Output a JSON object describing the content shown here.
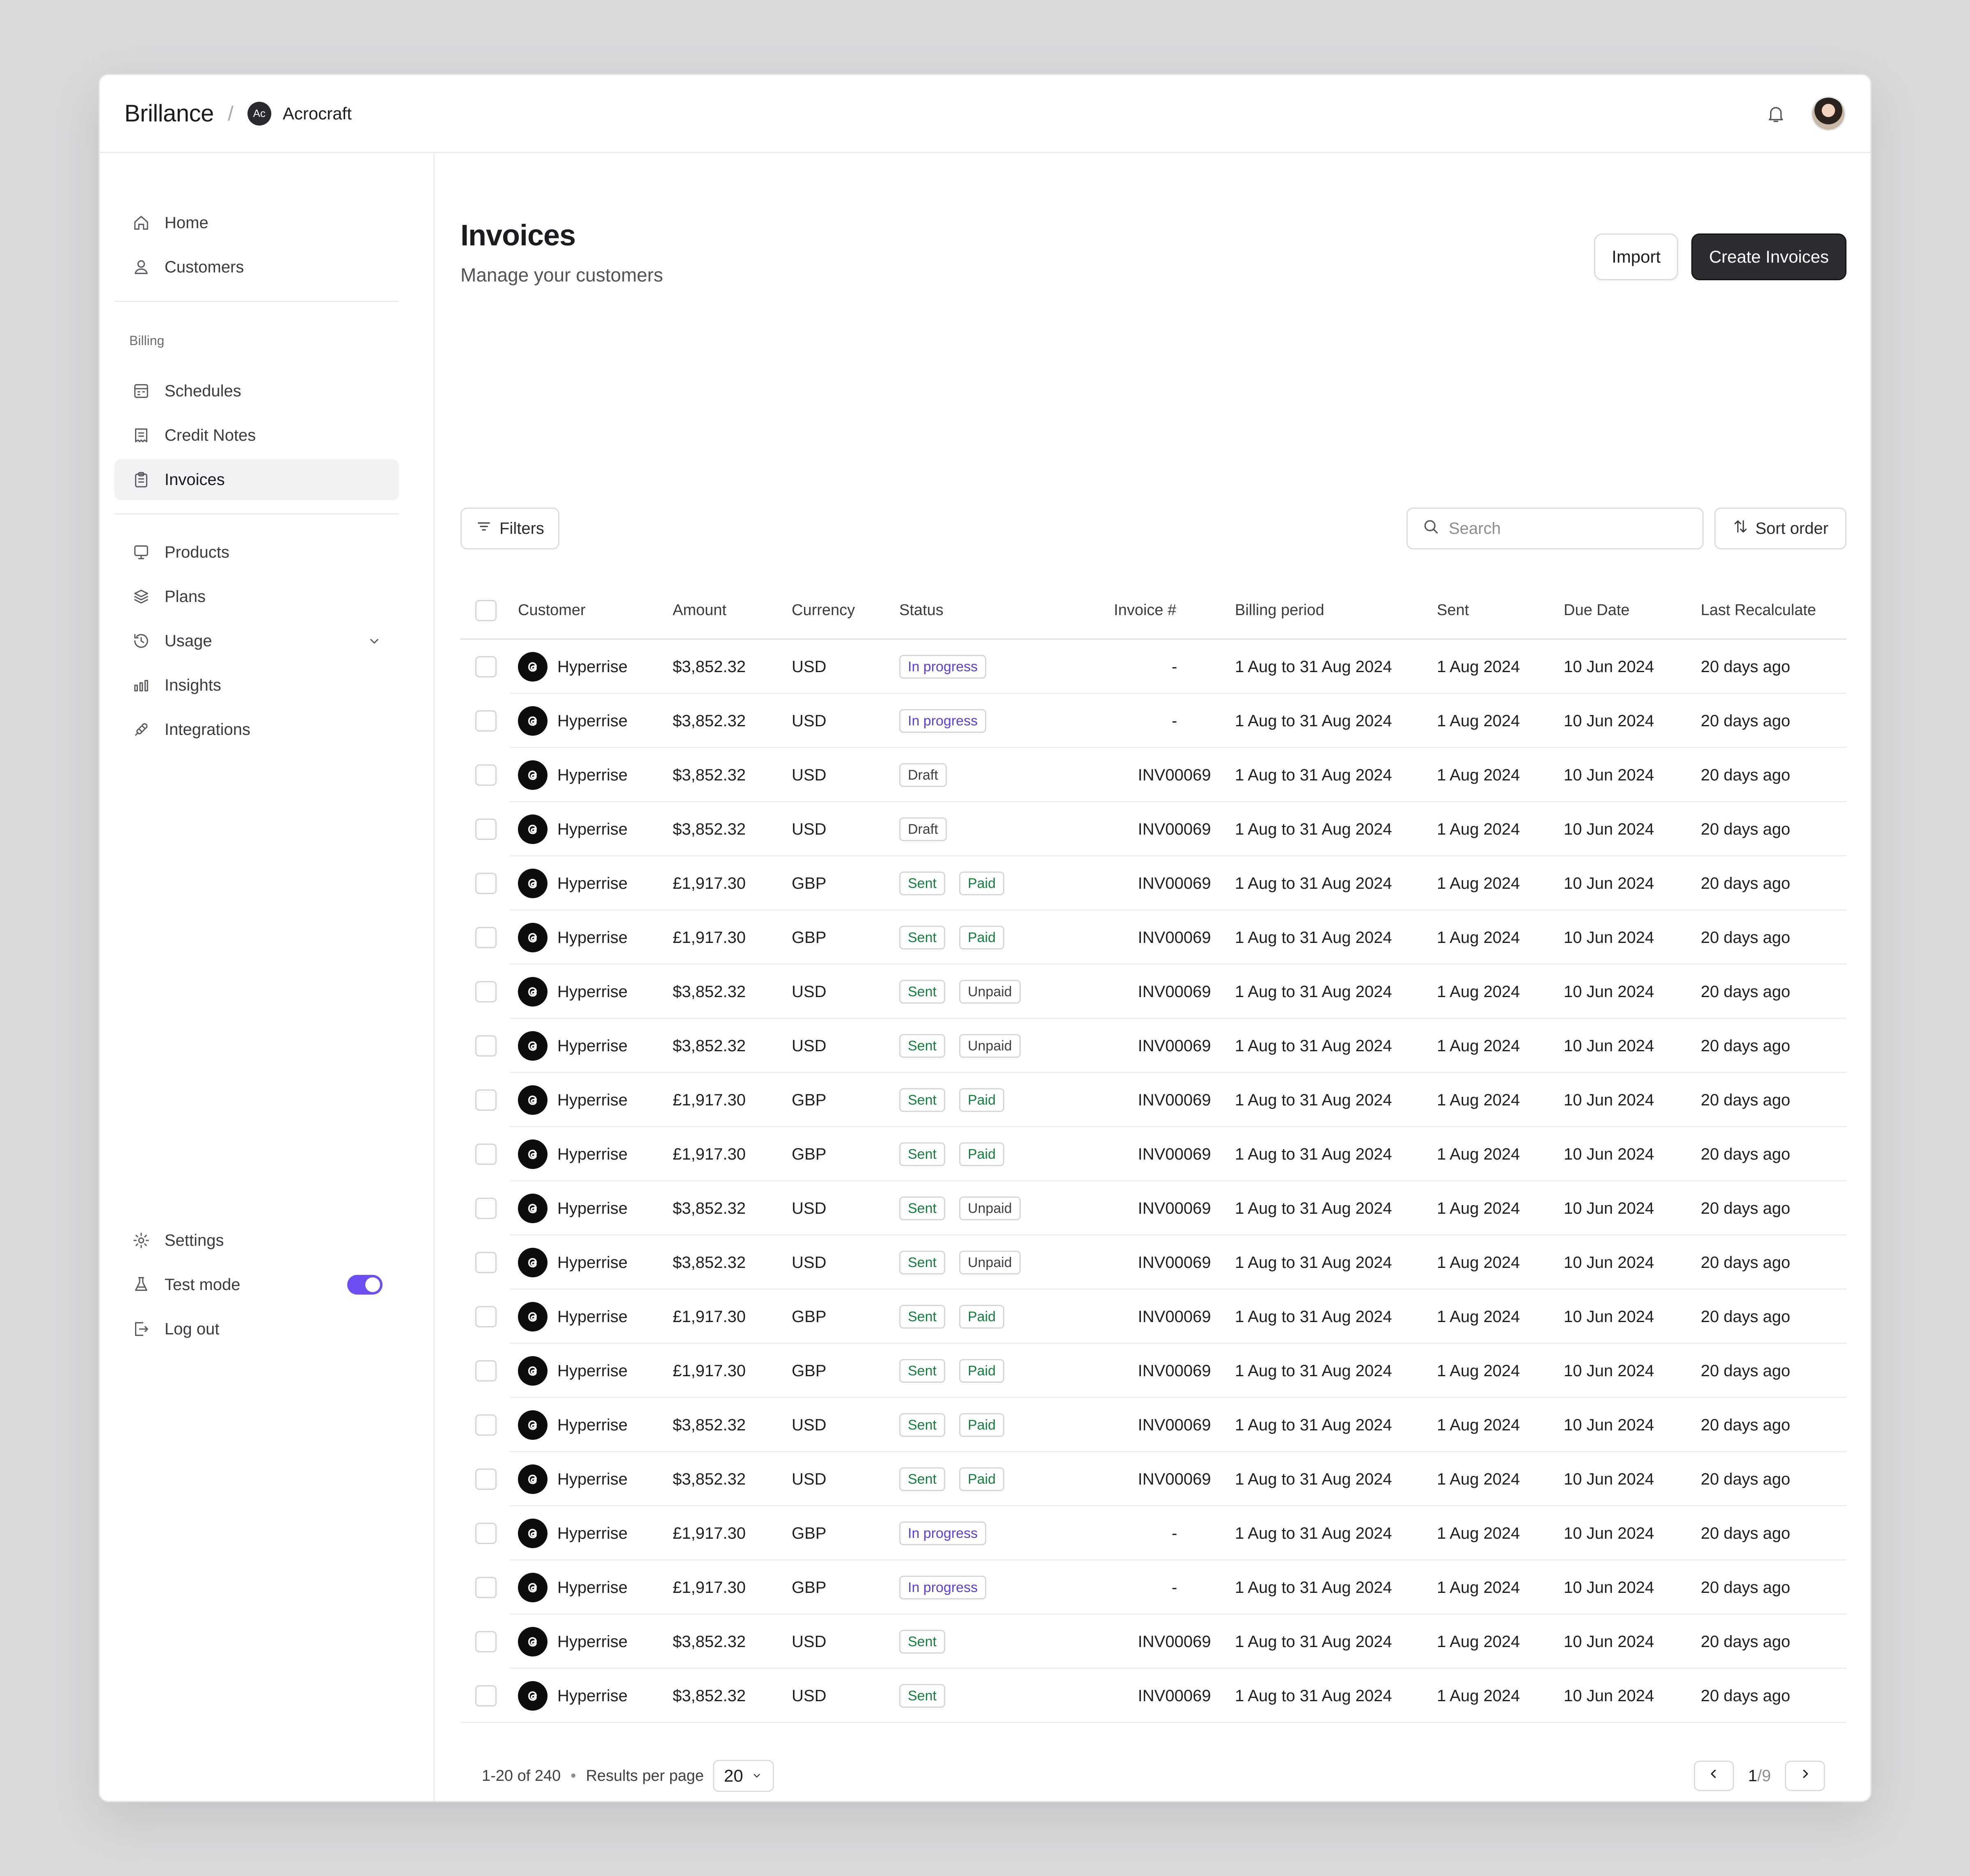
{
  "header": {
    "brand": "Brillance",
    "separator": "/",
    "org_initials": "Ac",
    "org_name": "Acrocraft"
  },
  "sidebar": {
    "primary": [
      {
        "label": "Home",
        "icon": "home-icon"
      },
      {
        "label": "Customers",
        "icon": "user-icon"
      }
    ],
    "billing_label": "Billing",
    "billing": [
      {
        "label": "Schedules",
        "icon": "calendar-icon"
      },
      {
        "label": "Credit Notes",
        "icon": "receipt-icon"
      },
      {
        "label": "Invoices",
        "icon": "clipboard-icon",
        "active": true
      }
    ],
    "catalog": [
      {
        "label": "Products",
        "icon": "monitor-icon"
      },
      {
        "label": "Plans",
        "icon": "layers-icon"
      },
      {
        "label": "Usage",
        "icon": "history-icon",
        "expandable": true
      },
      {
        "label": "Insights",
        "icon": "bar-chart-icon"
      },
      {
        "label": "Integrations",
        "icon": "plug-icon"
      }
    ],
    "bottom": [
      {
        "label": "Settings",
        "icon": "gear-icon"
      },
      {
        "label": "Test mode",
        "icon": "flask-icon",
        "toggle": true
      },
      {
        "label": "Log out",
        "icon": "logout-icon"
      }
    ]
  },
  "page": {
    "title": "Invoices",
    "subtitle": "Manage your customers",
    "import_label": "Import",
    "create_label": "Create Invoices"
  },
  "toolbar": {
    "filters_label": "Filters",
    "search_placeholder": "Search",
    "sort_label": "Sort order"
  },
  "table": {
    "columns": [
      "Customer",
      "Amount",
      "Currency",
      "Status",
      "Invoice #",
      "Billing period",
      "Sent",
      "Due Date",
      "Last Recalculate"
    ],
    "rows": [
      {
        "customer": "Hyperrise",
        "amount": "$3,852.32",
        "currency": "USD",
        "status": [
          "In progress"
        ],
        "invoice": "-",
        "billing": "1 Aug to 31 Aug 2024",
        "sent": "1 Aug 2024",
        "due": "10 Jun 2024",
        "recalc": "20 days ago"
      },
      {
        "customer": "Hyperrise",
        "amount": "$3,852.32",
        "currency": "USD",
        "status": [
          "In progress"
        ],
        "invoice": "-",
        "billing": "1 Aug to 31 Aug 2024",
        "sent": "1 Aug 2024",
        "due": "10 Jun 2024",
        "recalc": "20 days ago"
      },
      {
        "customer": "Hyperrise",
        "amount": "$3,852.32",
        "currency": "USD",
        "status": [
          "Draft"
        ],
        "invoice": "INV00069",
        "billing": "1 Aug to 31 Aug 2024",
        "sent": "1 Aug 2024",
        "due": "10 Jun 2024",
        "recalc": "20 days ago"
      },
      {
        "customer": "Hyperrise",
        "amount": "$3,852.32",
        "currency": "USD",
        "status": [
          "Draft"
        ],
        "invoice": "INV00069",
        "billing": "1 Aug to 31 Aug 2024",
        "sent": "1 Aug 2024",
        "due": "10 Jun 2024",
        "recalc": "20 days ago"
      },
      {
        "customer": "Hyperrise",
        "amount": "£1,917.30",
        "currency": "GBP",
        "status": [
          "Sent",
          "Paid"
        ],
        "invoice": "INV00069",
        "billing": "1 Aug to 31 Aug 2024",
        "sent": "1 Aug 2024",
        "due": "10 Jun 2024",
        "recalc": "20 days ago"
      },
      {
        "customer": "Hyperrise",
        "amount": "£1,917.30",
        "currency": "GBP",
        "status": [
          "Sent",
          "Paid"
        ],
        "invoice": "INV00069",
        "billing": "1 Aug to 31 Aug 2024",
        "sent": "1 Aug 2024",
        "due": "10 Jun 2024",
        "recalc": "20 days ago"
      },
      {
        "customer": "Hyperrise",
        "amount": "$3,852.32",
        "currency": "USD",
        "status": [
          "Sent",
          "Unpaid"
        ],
        "invoice": "INV00069",
        "billing": "1 Aug to 31 Aug 2024",
        "sent": "1 Aug 2024",
        "due": "10 Jun 2024",
        "recalc": "20 days ago"
      },
      {
        "customer": "Hyperrise",
        "amount": "$3,852.32",
        "currency": "USD",
        "status": [
          "Sent",
          "Unpaid"
        ],
        "invoice": "INV00069",
        "billing": "1 Aug to 31 Aug 2024",
        "sent": "1 Aug 2024",
        "due": "10 Jun 2024",
        "recalc": "20 days ago"
      },
      {
        "customer": "Hyperrise",
        "amount": "£1,917.30",
        "currency": "GBP",
        "status": [
          "Sent",
          "Paid"
        ],
        "invoice": "INV00069",
        "billing": "1 Aug to 31 Aug 2024",
        "sent": "1 Aug 2024",
        "due": "10 Jun 2024",
        "recalc": "20 days ago"
      },
      {
        "customer": "Hyperrise",
        "amount": "£1,917.30",
        "currency": "GBP",
        "status": [
          "Sent",
          "Paid"
        ],
        "invoice": "INV00069",
        "billing": "1 Aug to 31 Aug 2024",
        "sent": "1 Aug 2024",
        "due": "10 Jun 2024",
        "recalc": "20 days ago"
      },
      {
        "customer": "Hyperrise",
        "amount": "$3,852.32",
        "currency": "USD",
        "status": [
          "Sent",
          "Unpaid"
        ],
        "invoice": "INV00069",
        "billing": "1 Aug to 31 Aug 2024",
        "sent": "1 Aug 2024",
        "due": "10 Jun 2024",
        "recalc": "20 days ago"
      },
      {
        "customer": "Hyperrise",
        "amount": "$3,852.32",
        "currency": "USD",
        "status": [
          "Sent",
          "Unpaid"
        ],
        "invoice": "INV00069",
        "billing": "1 Aug to 31 Aug 2024",
        "sent": "1 Aug 2024",
        "due": "10 Jun 2024",
        "recalc": "20 days ago"
      },
      {
        "customer": "Hyperrise",
        "amount": "£1,917.30",
        "currency": "GBP",
        "status": [
          "Sent",
          "Paid"
        ],
        "invoice": "INV00069",
        "billing": "1 Aug to 31 Aug 2024",
        "sent": "1 Aug 2024",
        "due": "10 Jun 2024",
        "recalc": "20 days ago"
      },
      {
        "customer": "Hyperrise",
        "amount": "£1,917.30",
        "currency": "GBP",
        "status": [
          "Sent",
          "Paid"
        ],
        "invoice": "INV00069",
        "billing": "1 Aug to 31 Aug 2024",
        "sent": "1 Aug 2024",
        "due": "10 Jun 2024",
        "recalc": "20 days ago"
      },
      {
        "customer": "Hyperrise",
        "amount": "$3,852.32",
        "currency": "USD",
        "status": [
          "Sent",
          "Paid"
        ],
        "invoice": "INV00069",
        "billing": "1 Aug to 31 Aug 2024",
        "sent": "1 Aug 2024",
        "due": "10 Jun 2024",
        "recalc": "20 days ago"
      },
      {
        "customer": "Hyperrise",
        "amount": "$3,852.32",
        "currency": "USD",
        "status": [
          "Sent",
          "Paid"
        ],
        "invoice": "INV00069",
        "billing": "1 Aug to 31 Aug 2024",
        "sent": "1 Aug 2024",
        "due": "10 Jun 2024",
        "recalc": "20 days ago"
      },
      {
        "customer": "Hyperrise",
        "amount": "£1,917.30",
        "currency": "GBP",
        "status": [
          "In progress"
        ],
        "invoice": "-",
        "billing": "1 Aug to 31 Aug 2024",
        "sent": "1 Aug 2024",
        "due": "10 Jun 2024",
        "recalc": "20 days ago"
      },
      {
        "customer": "Hyperrise",
        "amount": "£1,917.30",
        "currency": "GBP",
        "status": [
          "In progress"
        ],
        "invoice": "-",
        "billing": "1 Aug to 31 Aug 2024",
        "sent": "1 Aug 2024",
        "due": "10 Jun 2024",
        "recalc": "20 days ago"
      },
      {
        "customer": "Hyperrise",
        "amount": "$3,852.32",
        "currency": "USD",
        "status": [
          "Sent"
        ],
        "invoice": "INV00069",
        "billing": "1 Aug to 31 Aug 2024",
        "sent": "1 Aug 2024",
        "due": "10 Jun 2024",
        "recalc": "20 days ago"
      },
      {
        "customer": "Hyperrise",
        "amount": "$3,852.32",
        "currency": "USD",
        "status": [
          "Sent"
        ],
        "invoice": "INV00069",
        "billing": "1 Aug to 31 Aug 2024",
        "sent": "1 Aug 2024",
        "due": "10 Jun 2024",
        "recalc": "20 days ago"
      }
    ]
  },
  "footer": {
    "range": "1-20 of 240",
    "separator": "•",
    "per_page_label": "Results per page",
    "per_page_value": "20",
    "page_current": "1",
    "page_total": "/9"
  },
  "colors": {
    "accent": "#6d4ef0",
    "primary_button": "#2c2c31",
    "status_progress": "#5b3fd8",
    "status_success": "#15803d"
  }
}
